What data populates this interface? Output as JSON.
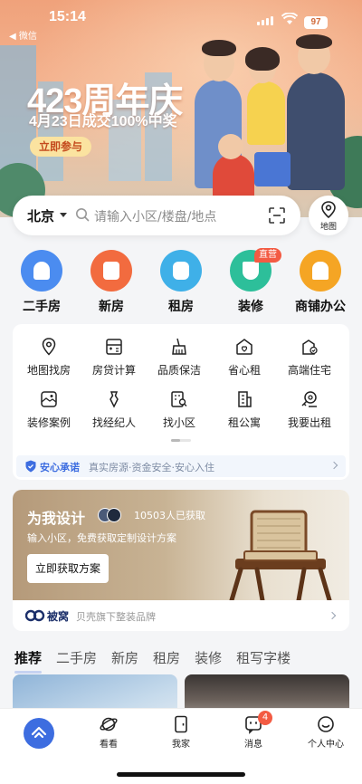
{
  "status_bar": {
    "time": "15:14",
    "back_app": "◀ 微信",
    "battery": "97"
  },
  "banner": {
    "title": "423周年庆",
    "subtitle": "4月23日成交100%中奖",
    "cta": "立即参与"
  },
  "search": {
    "city": "北京",
    "placeholder": "请输入小区/楼盘/地点",
    "map_label": "地图"
  },
  "categories": [
    {
      "label": "二手房",
      "color": "#4b8cf0",
      "icon": "house-icon"
    },
    {
      "label": "新房",
      "color": "#f26b3f",
      "icon": "building-icon"
    },
    {
      "label": "租房",
      "color": "#3fb0e8",
      "icon": "key-icon"
    },
    {
      "label": "装修",
      "color": "#2dbf9a",
      "icon": "paint-icon",
      "badge": "直营"
    },
    {
      "label": "商铺办公",
      "color": "#f5a524",
      "icon": "shop-icon"
    }
  ],
  "tools": [
    {
      "label": "地图找房",
      "icon": "map-pin-icon"
    },
    {
      "label": "房贷计算",
      "icon": "calculator-icon"
    },
    {
      "label": "品质保洁",
      "icon": "broom-icon"
    },
    {
      "label": "省心租",
      "icon": "heart-house-icon"
    },
    {
      "label": "高端住宅",
      "icon": "villa-icon"
    },
    {
      "label": "装修案例",
      "icon": "gallery-icon"
    },
    {
      "label": "找经纪人",
      "icon": "agent-icon"
    },
    {
      "label": "找小区",
      "icon": "community-icon"
    },
    {
      "label": "租公寓",
      "icon": "apartment-icon"
    },
    {
      "label": "我要出租",
      "icon": "key-rent-icon"
    }
  ],
  "promise": {
    "title": "安心承诺",
    "text": "真实房源·资金安全·安心入住"
  },
  "design": {
    "title": "为我设计",
    "count_text": "10503人已获取",
    "subtitle": "输入小区，免费获取定制设计方案",
    "cta": "立即获取方案",
    "brand_name": "被窝",
    "brand_desc": "贝壳旗下整装品牌"
  },
  "feed_tabs": [
    "推荐",
    "二手房",
    "新房",
    "租房",
    "装修",
    "租写字楼"
  ],
  "tabbar": [
    {
      "label": "",
      "icon": "home-icon"
    },
    {
      "label": "看看",
      "icon": "planet-icon"
    },
    {
      "label": "我家",
      "icon": "door-icon"
    },
    {
      "label": "消息",
      "icon": "message-icon",
      "badge": "4"
    },
    {
      "label": "个人中心",
      "icon": "smile-icon"
    }
  ],
  "colors": {
    "accent": "#3d6de0",
    "badge": "#f35b43"
  }
}
